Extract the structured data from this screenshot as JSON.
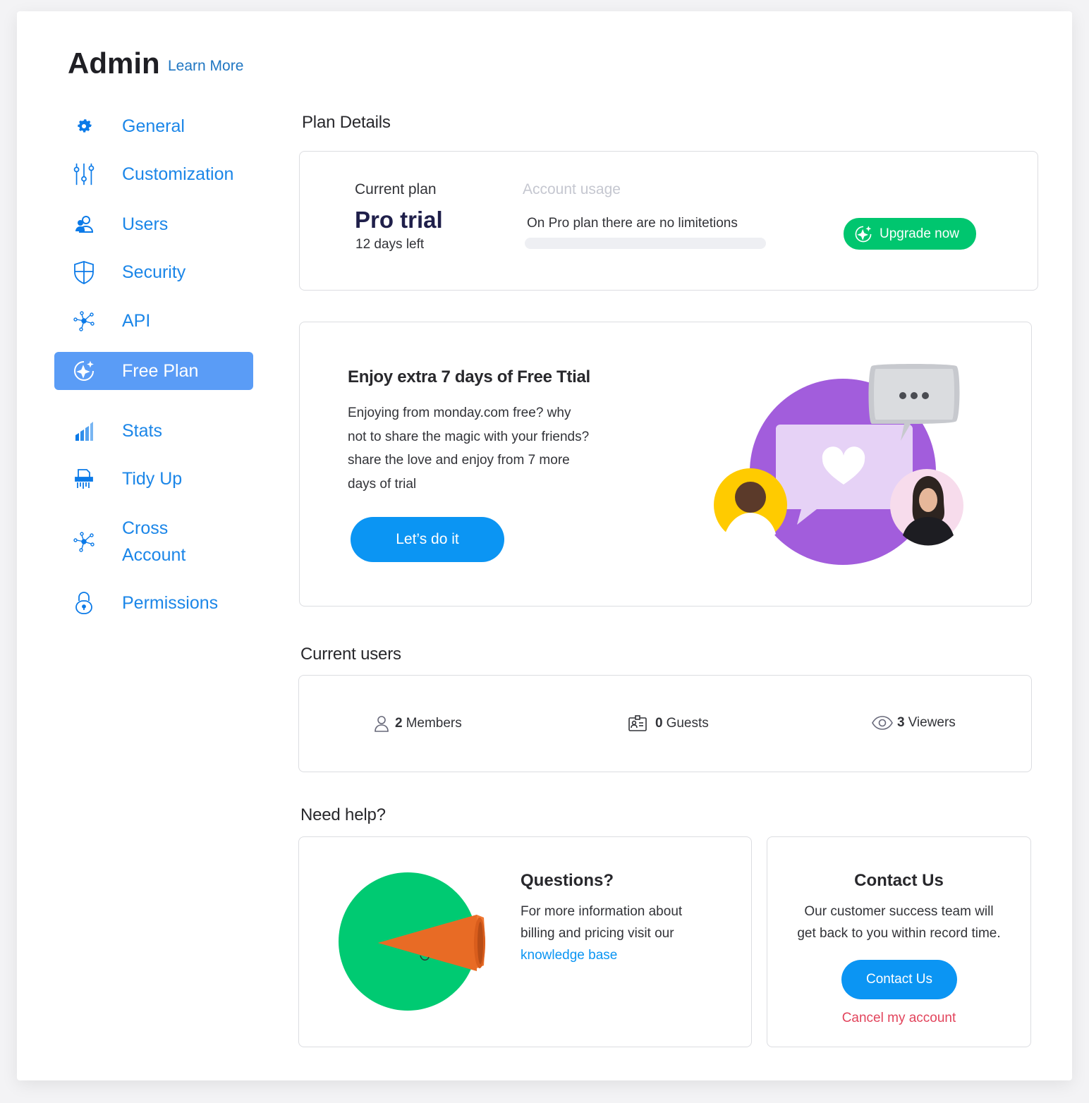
{
  "header": {
    "title": "Admin",
    "learn_more": "Learn More"
  },
  "sidebar": {
    "items": [
      {
        "label": "General",
        "icon": "gear-icon"
      },
      {
        "label": "Customization",
        "icon": "sliders-icon"
      },
      {
        "label": "Users",
        "icon": "users-icon"
      },
      {
        "label": "Security",
        "icon": "shield-icon"
      },
      {
        "label": "API",
        "icon": "api-nodes-icon"
      },
      {
        "label": "Free Plan",
        "icon": "sparkle-icon",
        "active": true
      },
      {
        "label": "Stats",
        "icon": "stats-icon"
      },
      {
        "label": "Tidy Up",
        "icon": "shredder-icon"
      },
      {
        "label_line1": "Cross",
        "label_line2": "Account",
        "icon": "cross-account-icon"
      },
      {
        "label": "Permissions",
        "icon": "lock-icon"
      }
    ]
  },
  "plan_details": {
    "section_title": "Plan Details",
    "current_plan_label": "Current plan",
    "plan_name": "Pro trial",
    "days_left": "12 days left",
    "account_usage_label": "Account usage",
    "usage_text": "On Pro plan there are no limitetions",
    "usage_fraction": 0,
    "upgrade_label": "Upgrade now"
  },
  "promo": {
    "title": "Enjoy extra 7 days of Free Ttial",
    "body_line1": "Enjoying from monday.com free? why",
    "body_line2": "not to share the magic with your friends?",
    "body_line3": "share the love and enjoy from 7 more",
    "body_line4": "days of trial",
    "cta": "Let’s do it"
  },
  "current_users": {
    "section_title": "Current users",
    "members_count": "2",
    "members_label": "Members",
    "guests_count": "0",
    "guests_label": "Guests",
    "viewers_count": "3",
    "viewers_label": "Viewers"
  },
  "help": {
    "section_title": "Need help?",
    "questions_title": "Questions?",
    "questions_line1": "For more information about",
    "questions_line2": "billing and pricing visit our",
    "knowledge_link": "knowledge base",
    "contact_title": "Contact Us",
    "contact_line1": "Our customer success team will",
    "contact_line2": "get back to you within record time.",
    "contact_button": "Contact Us",
    "cancel_link": "Cancel my account"
  },
  "colors": {
    "accent_blue": "#0b95f3",
    "nav_active": "#5a9cf6",
    "green": "#00c66f",
    "purple": "#a25ddc",
    "danger": "#e2445c"
  }
}
